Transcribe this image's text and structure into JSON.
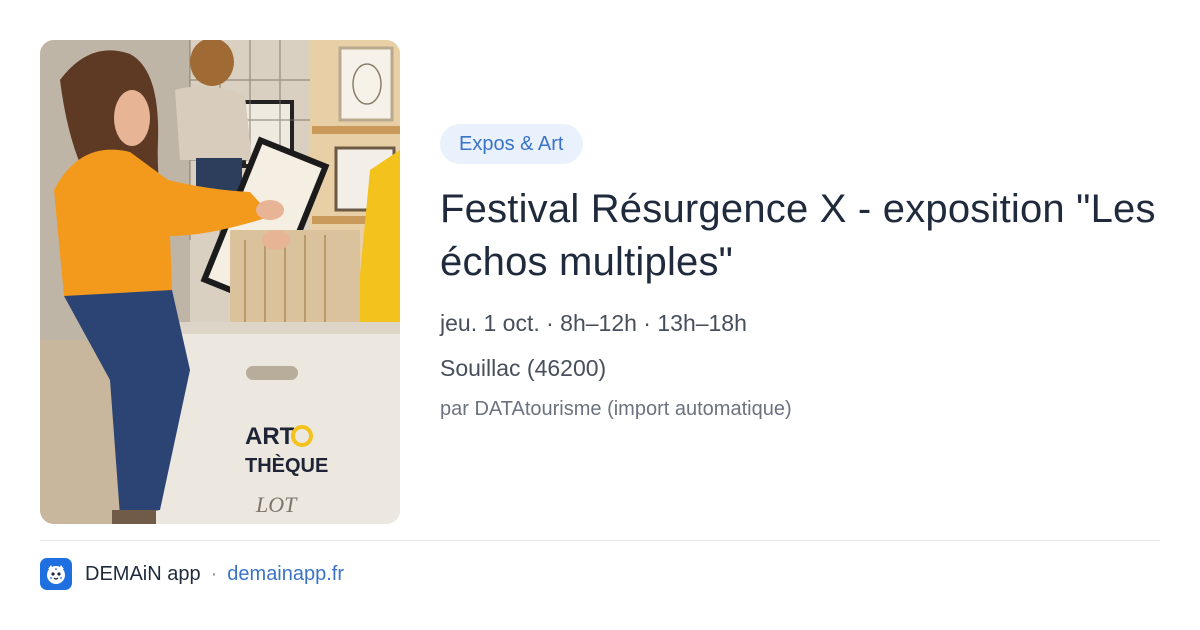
{
  "event": {
    "category": "Expos & Art",
    "title": "Festival Résurgence X - exposition \"Les échos multiples\"",
    "when": "jeu. 1 oct. · 8h–12h · 13h–18h",
    "where": "Souillac (46200)",
    "source": "par DATAtourisme (import automatique)"
  },
  "photo": {
    "box_text_line1": "ART",
    "box_text_line2": "THÈQUE",
    "box_stamp": "LOT"
  },
  "footer": {
    "app_icon": "snow-leopard-logo-icon",
    "app_name": "DEMAiN app",
    "separator": "·",
    "link": "demainapp.fr"
  },
  "colors": {
    "accent": "#3a73c6",
    "chip_bg": "#e9f1fd",
    "title": "#1f2a3c",
    "brand_blue": "#1e6fe0"
  }
}
